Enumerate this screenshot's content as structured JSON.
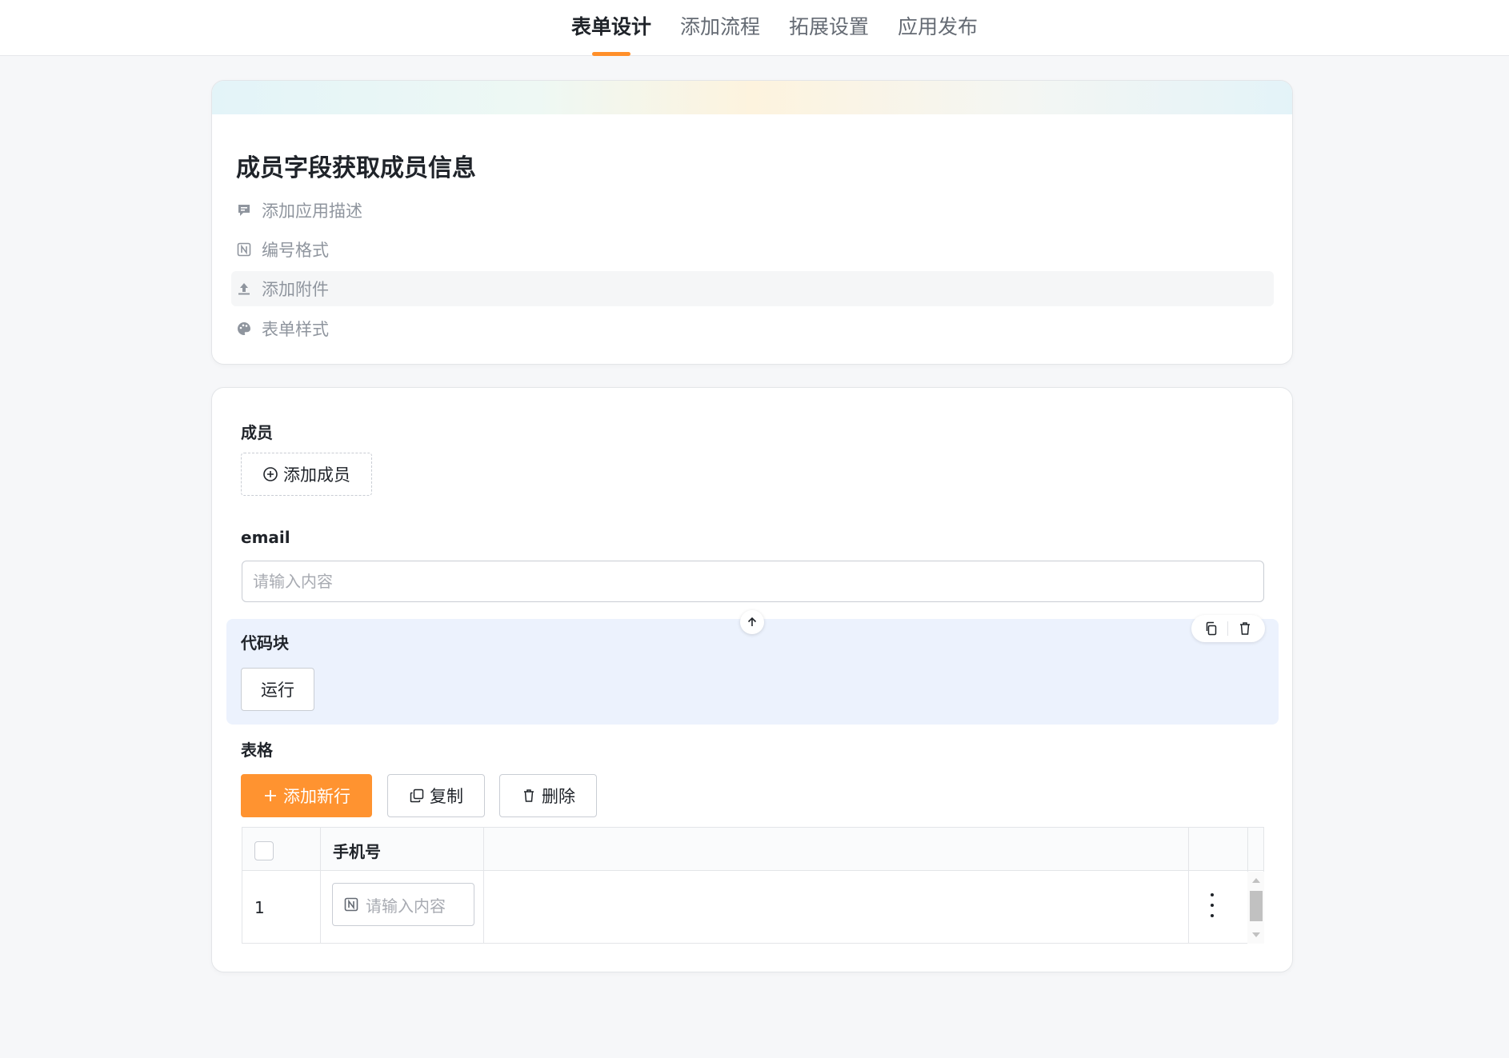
{
  "nav": {
    "tabs": [
      {
        "label": "表单设计",
        "active": true
      },
      {
        "label": "添加流程",
        "active": false
      },
      {
        "label": "拓展设置",
        "active": false
      },
      {
        "label": "应用发布",
        "active": false
      }
    ]
  },
  "app": {
    "title": "成员字段获取成员信息",
    "meta": [
      {
        "icon": "comment-icon",
        "label": "添加应用描述"
      },
      {
        "icon": "number-format-icon",
        "label": "编号格式"
      },
      {
        "icon": "upload-icon",
        "label": "添加附件"
      },
      {
        "icon": "palette-icon",
        "label": "表单样式"
      }
    ]
  },
  "form": {
    "member": {
      "label": "成员",
      "add_button": "添加成员"
    },
    "email": {
      "label": "email",
      "placeholder": "请输入内容"
    },
    "code_block": {
      "label": "代码块",
      "run_button": "运行"
    },
    "table": {
      "label": "表格",
      "add_row_button": "添加新行",
      "copy_button": "复制",
      "delete_button": "删除",
      "columns": [
        "手机号"
      ],
      "rows": [
        {
          "index": "1",
          "placeholder": "请输入内容"
        }
      ]
    }
  },
  "colors": {
    "accent": "#ff8f2a",
    "primary_button": "#ff9330",
    "code_block_bg": "#ecf2fd"
  }
}
